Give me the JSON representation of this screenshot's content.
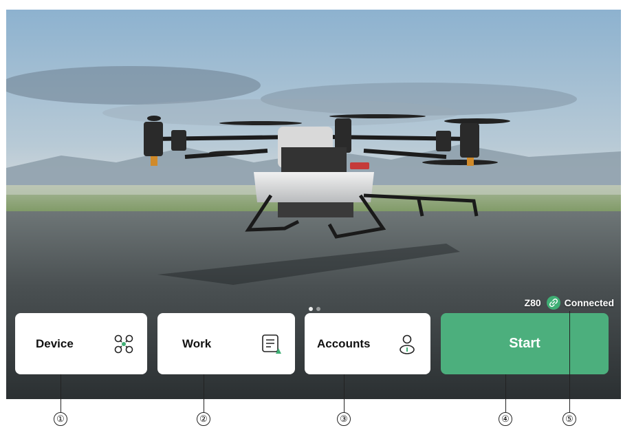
{
  "status": {
    "model": "Z80",
    "connection": "Connected"
  },
  "cards": {
    "device": {
      "label": "Device",
      "icon": "drone-icon"
    },
    "work": {
      "label": "Work",
      "icon": "task-list-icon"
    },
    "accounts": {
      "label": "Accounts",
      "icon": "user-icon"
    }
  },
  "start": {
    "label": "Start"
  },
  "callouts": [
    "①",
    "②",
    "③",
    "④",
    "⑤"
  ],
  "colors": {
    "accent": "#4caf7d",
    "card": "#ffffff",
    "link_badge": "#3fae74"
  }
}
